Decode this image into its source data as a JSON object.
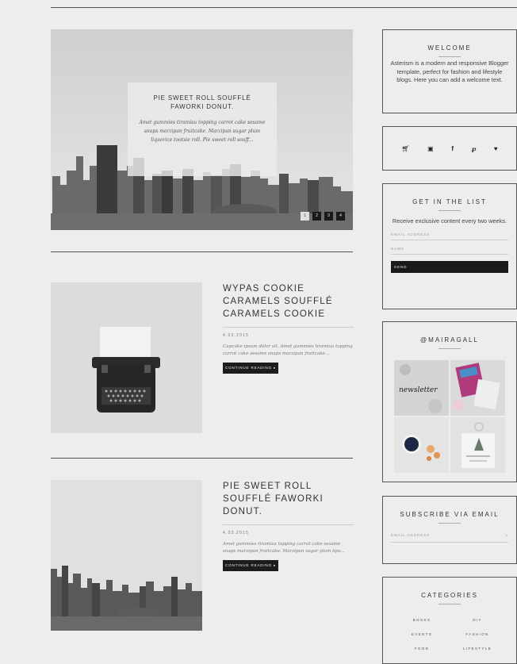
{
  "slider": {
    "title": "PIE SWEET ROLL SOUFFLÉ FAWORKI DONUT.",
    "text": "Amet gummies tiramisu topping carrot cake sesame snaps marzipan fruitcake. Marzipan sugar plum liquorice tootsie roll. Pie sweet roll souff...",
    "dots": [
      "1",
      "2",
      "3",
      "4"
    ]
  },
  "posts": [
    {
      "title": "WYPAS COOKIE CARAMELS SOUFFLÉ CARAMELS COOKIE",
      "date": "4.03.2015",
      "excerpt": "Cupcake ipsum dolor sit. Amet gummies tiramisu topping carrot cake sesame snaps marzipan fruitcake...",
      "button": "CONTINUE READING ▸"
    },
    {
      "title": "PIE SWEET ROLL SOUFFLÉ FAWORKI DONUT.",
      "date": "4.03.2015",
      "excerpt": "Amet gummies tiramisu topping carrot cake sesame snaps marzipan fruitcake. Marzipan sugar plum lipo...",
      "button": "CONTINUE READING ▸"
    }
  ],
  "sidebar": {
    "welcome": {
      "title": "WELCOME",
      "text": "Asterism is a modern and responsive Blogger template, perfect for fashion and lifestyle blogs. Here you can add a welcome text."
    },
    "social": [
      "cart-icon",
      "instagram-icon",
      "facebook-icon",
      "pinterest-icon",
      "heart-icon"
    ],
    "list": {
      "title": "GET IN THE LIST",
      "text": "Receive exclusive content every two weeks.",
      "email_placeholder": "EMAIL ADDRESS",
      "name_placeholder": "NAME",
      "send_label": "SEND"
    },
    "instagram": {
      "title": "@MAIRAGALL",
      "tile1_text": "newsletter"
    },
    "subscribe": {
      "title": "SUBSCRIBE VIA EMAIL",
      "email_placeholder": "EMAIL ADDRESS",
      "arrow": "›"
    },
    "categories": {
      "title": "CATEGORIES",
      "items": [
        "BOOKS",
        "DIY",
        "EVENTS",
        "FASHION",
        "FOOD",
        "LIFESTYLE"
      ]
    }
  }
}
